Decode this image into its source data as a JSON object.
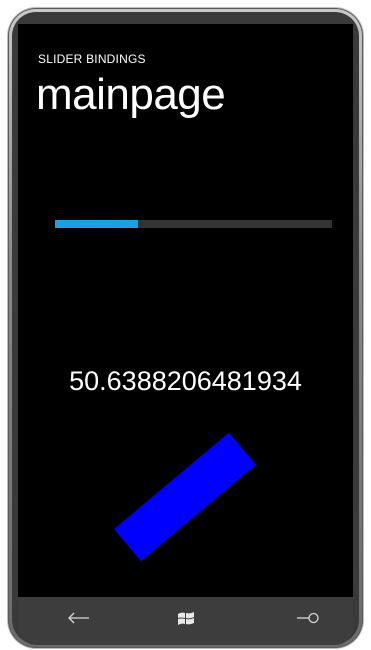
{
  "app": {
    "title": "SLIDER BINDINGS",
    "page_title": "mainpage"
  },
  "slider": {
    "value": 50.6388206481934,
    "max": 360,
    "fill_fraction": 0.3
  },
  "value_display": "50.6388206481934",
  "rectangle": {
    "color": "#0000ff",
    "rotation_degrees": -40
  },
  "appbar": {
    "back_icon": "back-arrow-icon",
    "start_icon": "windows-logo-icon",
    "search_icon": "search-icon"
  },
  "colors": {
    "accent": "#1ba1e2",
    "track": "#333333",
    "background": "#000000",
    "text": "#ffffff"
  }
}
